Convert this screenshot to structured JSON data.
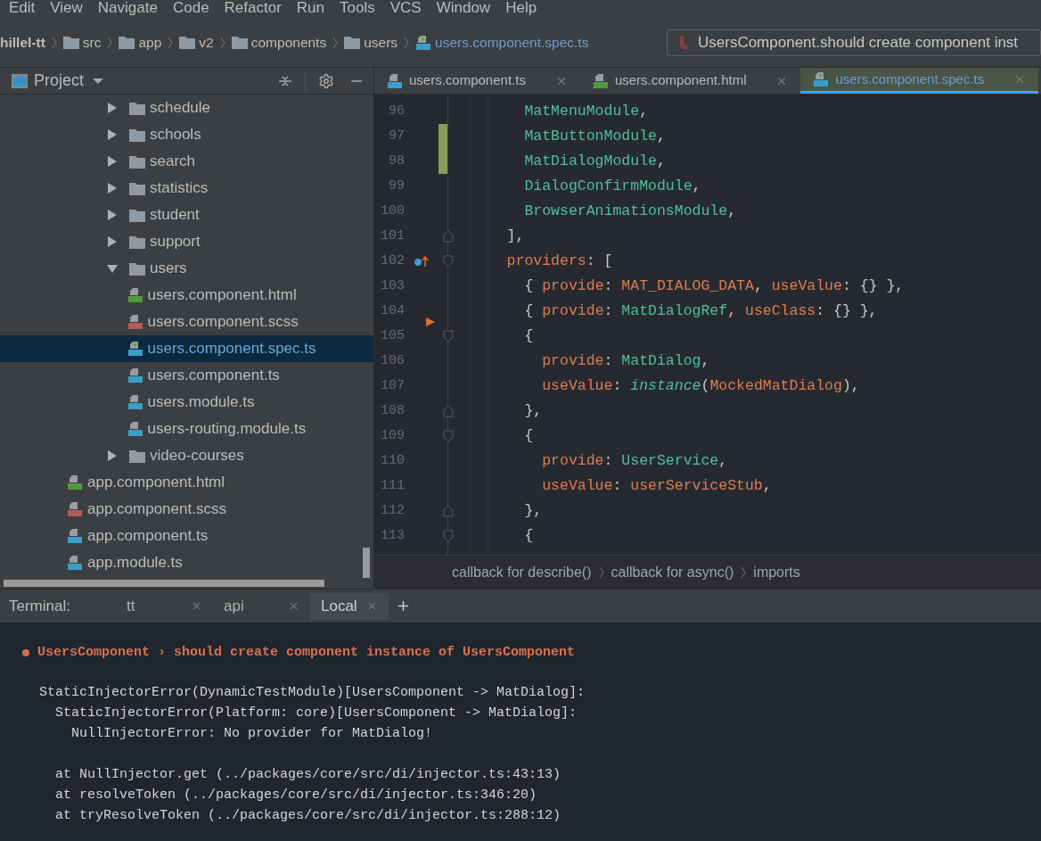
{
  "menu": [
    "Edit",
    "View",
    "Navigate",
    "Code",
    "Refactor",
    "Run",
    "Tools",
    "VCS",
    "Window",
    "Help"
  ],
  "breadcrumb": [
    {
      "label": "hillel-tt",
      "kind": "project"
    },
    {
      "label": "src",
      "kind": "folder"
    },
    {
      "label": "app",
      "kind": "folder"
    },
    {
      "label": "v2",
      "kind": "folder"
    },
    {
      "label": "components",
      "kind": "folder"
    },
    {
      "label": "users",
      "kind": "folder"
    },
    {
      "label": "users.component.spec.ts",
      "kind": "spec"
    }
  ],
  "run_config": {
    "label": "UsersComponent.should create component inst"
  },
  "project_panel": {
    "title": "Project",
    "tree": [
      {
        "kind": "group",
        "children": [
          {
            "name": "schedule",
            "kind": "folder",
            "expanded": false,
            "selected": false
          },
          {
            "name": "schools",
            "kind": "folder",
            "expanded": false,
            "selected": false
          },
          {
            "name": "search",
            "kind": "folder",
            "expanded": false,
            "selected": false
          },
          {
            "name": "statistics",
            "kind": "folder",
            "expanded": false,
            "selected": false
          },
          {
            "name": "student",
            "kind": "folder",
            "expanded": false,
            "selected": false
          },
          {
            "name": "support",
            "kind": "folder",
            "expanded": false,
            "selected": false
          },
          {
            "name": "users",
            "kind": "folder",
            "expanded": true,
            "selected": false,
            "children": [
              {
                "name": "users.component.html",
                "kind": "html",
                "selected": false
              },
              {
                "name": "users.component.scss",
                "kind": "scss",
                "selected": false
              },
              {
                "name": "users.component.spec.ts",
                "kind": "spec",
                "selected": true
              },
              {
                "name": "users.component.ts",
                "kind": "ts",
                "selected": false
              },
              {
                "name": "users.module.ts",
                "kind": "ts",
                "selected": false
              },
              {
                "name": "users-routing.module.ts",
                "kind": "ts",
                "selected": false
              }
            ]
          },
          {
            "name": "video-courses",
            "kind": "folder",
            "expanded": false,
            "selected": false
          }
        ]
      },
      {
        "name": "app.component.html",
        "kind": "html",
        "selected": false
      },
      {
        "name": "app.component.scss",
        "kind": "scss",
        "selected": false
      },
      {
        "name": "app.component.ts",
        "kind": "ts",
        "selected": false
      },
      {
        "name": "app.module.ts",
        "kind": "ts",
        "selected": false
      }
    ]
  },
  "editor_tabs": [
    {
      "label": "users.component.ts",
      "kind": "ts",
      "selected": false
    },
    {
      "label": "users.component.html",
      "kind": "html",
      "selected": false
    },
    {
      "label": "users.component.spec.ts",
      "kind": "spec",
      "selected": true
    }
  ],
  "code_lines": [
    {
      "number": "96",
      "changed": false,
      "fold_start": false,
      "fold_end": false,
      "override_marker": false,
      "run_marker": false,
      "tokens": [
        {
          "text": "      MatMenuModule",
          "kind": "type"
        },
        {
          "text": ",",
          "kind": "plain"
        }
      ]
    },
    {
      "number": "97",
      "changed": true,
      "fold_start": false,
      "fold_end": false,
      "override_marker": false,
      "run_marker": false,
      "tokens": [
        {
          "text": "      MatButtonModule",
          "kind": "type"
        },
        {
          "text": ",",
          "kind": "plain"
        }
      ]
    },
    {
      "number": "98",
      "changed": true,
      "fold_start": false,
      "fold_end": false,
      "override_marker": false,
      "run_marker": false,
      "tokens": [
        {
          "text": "      MatDialogModule",
          "kind": "type"
        },
        {
          "text": ",",
          "kind": "plain"
        }
      ]
    },
    {
      "number": "99",
      "changed": false,
      "fold_start": false,
      "fold_end": false,
      "override_marker": false,
      "run_marker": false,
      "tokens": [
        {
          "text": "      DialogConfirmModule",
          "kind": "type"
        },
        {
          "text": ",",
          "kind": "plain"
        }
      ]
    },
    {
      "number": "100",
      "changed": false,
      "fold_start": false,
      "fold_end": false,
      "override_marker": false,
      "run_marker": false,
      "tokens": [
        {
          "text": "      BrowserAnimationsModule",
          "kind": "type"
        },
        {
          "text": ",",
          "kind": "plain"
        }
      ]
    },
    {
      "number": "101",
      "changed": false,
      "fold_start": false,
      "fold_end": true,
      "override_marker": false,
      "run_marker": false,
      "tokens": [
        {
          "text": "    ],",
          "kind": "plain"
        }
      ]
    },
    {
      "number": "102",
      "changed": false,
      "fold_start": true,
      "fold_end": false,
      "override_marker": true,
      "run_marker": false,
      "tokens": [
        {
          "text": "    providers",
          "kind": "prop"
        },
        {
          "text": ": [",
          "kind": "plain"
        }
      ]
    },
    {
      "number": "103",
      "changed": false,
      "fold_start": false,
      "fold_end": false,
      "override_marker": false,
      "run_marker": false,
      "tokens": [
        {
          "text": "      { ",
          "kind": "plain"
        },
        {
          "text": "provide",
          "kind": "prop"
        },
        {
          "text": ": ",
          "kind": "plain"
        },
        {
          "text": "MAT_DIALOG_DATA",
          "kind": "prop"
        },
        {
          "text": ", ",
          "kind": "plain"
        },
        {
          "text": "useValue",
          "kind": "prop"
        },
        {
          "text": ": {} },",
          "kind": "plain"
        }
      ]
    },
    {
      "number": "104",
      "changed": false,
      "fold_start": false,
      "fold_end": false,
      "override_marker": false,
      "run_marker": true,
      "tokens": [
        {
          "text": "      { ",
          "kind": "plain"
        },
        {
          "text": "provide",
          "kind": "prop"
        },
        {
          "text": ": ",
          "kind": "plain"
        },
        {
          "text": "MatDialogRef",
          "kind": "type"
        },
        {
          "text": ", ",
          "kind": "plain"
        },
        {
          "text": "useClass",
          "kind": "prop"
        },
        {
          "text": ": {} },",
          "kind": "plain"
        }
      ]
    },
    {
      "number": "105",
      "changed": false,
      "fold_start": true,
      "fold_end": false,
      "override_marker": false,
      "run_marker": false,
      "tokens": [
        {
          "text": "      {",
          "kind": "plain"
        }
      ]
    },
    {
      "number": "106",
      "changed": false,
      "fold_start": false,
      "fold_end": false,
      "override_marker": false,
      "run_marker": false,
      "tokens": [
        {
          "text": "        provide",
          "kind": "prop"
        },
        {
          "text": ": ",
          "kind": "plain"
        },
        {
          "text": "MatDialog",
          "kind": "type"
        },
        {
          "text": ",",
          "kind": "plain"
        }
      ]
    },
    {
      "number": "107",
      "changed": false,
      "fold_start": false,
      "fold_end": false,
      "override_marker": false,
      "run_marker": false,
      "tokens": [
        {
          "text": "        useValue",
          "kind": "prop"
        },
        {
          "text": ": ",
          "kind": "plain"
        },
        {
          "text": "instance",
          "kind": "call"
        },
        {
          "text": "(",
          "kind": "plain"
        },
        {
          "text": "MockedMatDialog",
          "kind": "prop"
        },
        {
          "text": "),",
          "kind": "plain"
        }
      ]
    },
    {
      "number": "108",
      "changed": false,
      "fold_start": false,
      "fold_end": true,
      "override_marker": false,
      "run_marker": false,
      "tokens": [
        {
          "text": "      },",
          "kind": "plain"
        }
      ]
    },
    {
      "number": "109",
      "changed": false,
      "fold_start": true,
      "fold_end": false,
      "override_marker": false,
      "run_marker": false,
      "tokens": [
        {
          "text": "      {",
          "kind": "plain"
        }
      ]
    },
    {
      "number": "110",
      "changed": false,
      "fold_start": false,
      "fold_end": false,
      "override_marker": false,
      "run_marker": false,
      "tokens": [
        {
          "text": "        provide",
          "kind": "prop"
        },
        {
          "text": ": ",
          "kind": "plain"
        },
        {
          "text": "UserService",
          "kind": "type"
        },
        {
          "text": ",",
          "kind": "plain"
        }
      ]
    },
    {
      "number": "111",
      "changed": false,
      "fold_start": false,
      "fold_end": false,
      "override_marker": false,
      "run_marker": false,
      "tokens": [
        {
          "text": "        useValue",
          "kind": "prop"
        },
        {
          "text": ": ",
          "kind": "plain"
        },
        {
          "text": "userServiceStub",
          "kind": "prop"
        },
        {
          "text": ",",
          "kind": "plain"
        }
      ]
    },
    {
      "number": "112",
      "changed": false,
      "fold_start": false,
      "fold_end": true,
      "override_marker": false,
      "run_marker": false,
      "tokens": [
        {
          "text": "      },",
          "kind": "plain"
        }
      ]
    },
    {
      "number": "113",
      "changed": false,
      "fold_start": true,
      "fold_end": false,
      "override_marker": false,
      "run_marker": false,
      "tokens": [
        {
          "text": "      {",
          "kind": "plain"
        }
      ]
    }
  ],
  "editor_breadcrumb": [
    "callback for describe()",
    "callback for async()",
    "imports"
  ],
  "terminal": {
    "label": "Terminal:",
    "tabs": [
      {
        "label": "tt",
        "selected": false
      },
      {
        "label": "api",
        "selected": false
      },
      {
        "label": "Local",
        "selected": true
      }
    ],
    "lines": [
      {
        "kind": "error",
        "text": "UsersComponent › should create component instance of UsersComponent"
      },
      {
        "kind": "plain",
        "text": "StaticInjectorError(DynamicTestModule)[UsersComponent -> MatDialog]:"
      },
      {
        "kind": "plain",
        "text": "  StaticInjectorError(Platform: core)[UsersComponent -> MatDialog]:"
      },
      {
        "kind": "plain",
        "text": "    NullInjectorError: No provider for MatDialog!"
      },
      {
        "kind": "blank"
      },
      {
        "kind": "plain",
        "text": "  at NullInjector.get (../packages/core/src/di/injector.ts:43:13)"
      },
      {
        "kind": "plain",
        "text": "  at resolveToken (../packages/core/src/di/injector.ts:346:20)"
      },
      {
        "kind": "plain",
        "text": "  at tryResolveToken (../packages/core/src/di/injector.ts:288:12)"
      }
    ]
  }
}
